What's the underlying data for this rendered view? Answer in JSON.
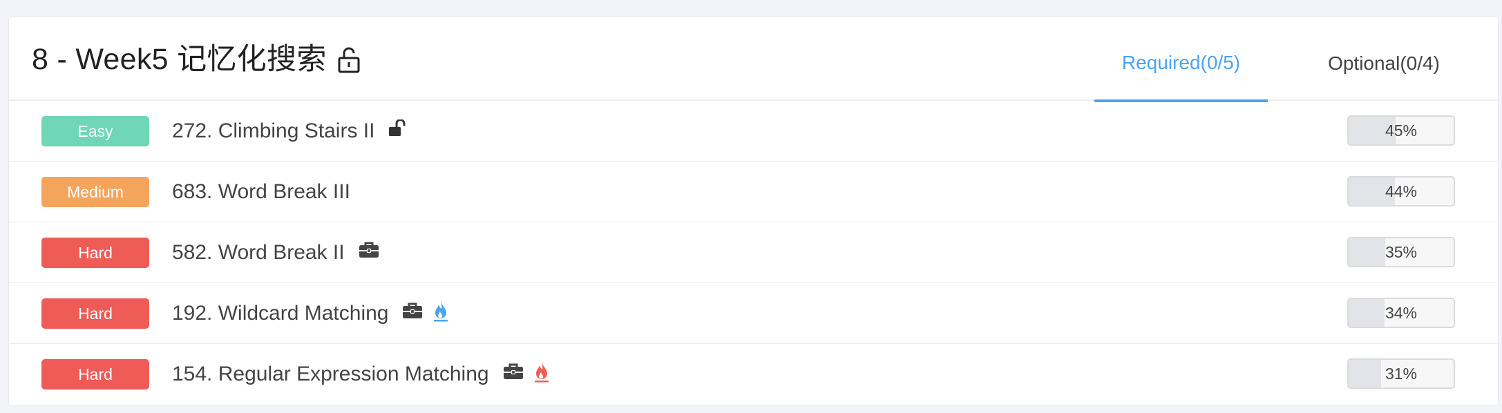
{
  "header": {
    "title": "8 - Week5 记忆化搜索",
    "title_icon": "unlock-icon",
    "tabs": [
      {
        "label": "Required(0/5)",
        "active": true
      },
      {
        "label": "Optional(0/4)",
        "active": false
      }
    ]
  },
  "colors": {
    "accent": "#4aa3f0",
    "easy": "#6fd6b6",
    "medium": "#f5a55b",
    "hard": "#ef5b56",
    "flame_blue": "#4aa3f0",
    "flame_red": "#ef5b56"
  },
  "problems": [
    {
      "difficulty": "Easy",
      "title": "272. Climbing Stairs II",
      "icons": [
        "unlock-icon"
      ],
      "progress_label": "45%",
      "progress": 45
    },
    {
      "difficulty": "Medium",
      "title": "683. Word Break III",
      "icons": [],
      "progress_label": "44%",
      "progress": 44
    },
    {
      "difficulty": "Hard",
      "title": "582. Word Break II",
      "icons": [
        "briefcase-icon"
      ],
      "progress_label": "35%",
      "progress": 35
    },
    {
      "difficulty": "Hard",
      "title": "192. Wildcard Matching",
      "icons": [
        "briefcase-icon",
        "flame-blue-icon"
      ],
      "progress_label": "34%",
      "progress": 34
    },
    {
      "difficulty": "Hard",
      "title": "154. Regular Expression Matching",
      "icons": [
        "briefcase-icon",
        "flame-red-icon"
      ],
      "progress_label": "31%",
      "progress": 31
    }
  ]
}
